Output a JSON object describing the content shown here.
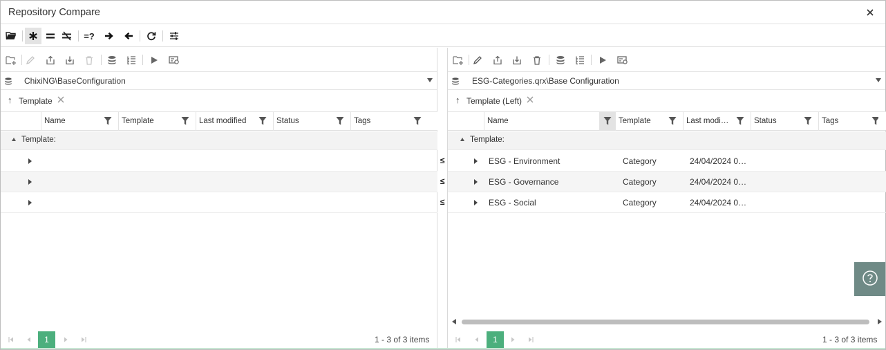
{
  "window": {
    "title": "Repository Compare"
  },
  "toolbar": {
    "items": [
      "folder-open-icon",
      "asterisk-icon",
      "equals-icon",
      "not-equal-icon",
      "question-equal-icon",
      "arrow-right-icon",
      "arrow-left-icon",
      "refresh-icon",
      "settings-sliders-icon"
    ],
    "question_equal_label": "=?"
  },
  "left": {
    "repo_path": "ChixiNG\\BaseConfiguration",
    "group_label": "Template",
    "columns": [
      "Name",
      "Template",
      "Last modified",
      "Status",
      "Tags"
    ],
    "group_band": "Template:",
    "rows": [
      {
        "name": "",
        "template": "",
        "modified": "",
        "compare": "≤"
      },
      {
        "name": "",
        "template": "",
        "modified": "",
        "compare": "≤"
      },
      {
        "name": "",
        "template": "",
        "modified": "",
        "compare": "≤"
      }
    ],
    "page": "1",
    "page_info": "1 - 3 of 3 items"
  },
  "right": {
    "repo_path": "ESG-Categories.qrx\\Base Configuration",
    "group_label": "Template (Left)",
    "columns": [
      "Name",
      "Template",
      "Last modi…",
      "Status",
      "Tags"
    ],
    "group_band": "Template:",
    "rows": [
      {
        "name": "ESG - Environment",
        "template": "Category",
        "modified": "24/04/2024 0…"
      },
      {
        "name": "ESG - Governance",
        "template": "Category",
        "modified": "24/04/2024 0…"
      },
      {
        "name": "ESG - Social",
        "template": "Category",
        "modified": "24/04/2024 0…"
      }
    ],
    "page": "1",
    "page_info": "1 - 3 of 3 items"
  },
  "help": {
    "icon": "question-circle-icon"
  }
}
